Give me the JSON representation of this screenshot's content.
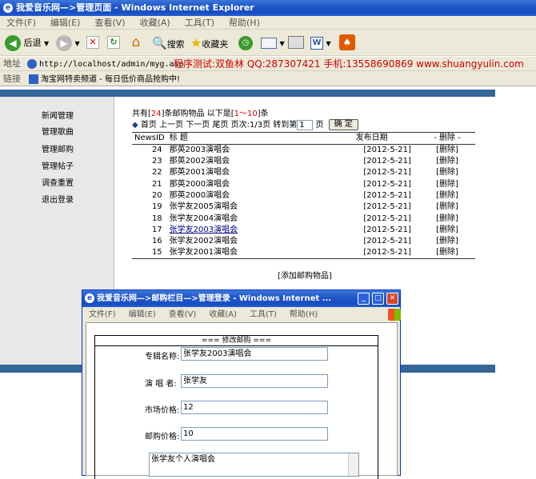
{
  "window": {
    "title": "我爱音乐网—>管理页面 - Windows Internet Explorer",
    "menu": [
      "文件(F)",
      "编辑(E)",
      "查看(V)",
      "收藏(A)",
      "工具(T)",
      "帮助(H)"
    ]
  },
  "toolbar": {
    "back_label": "后退",
    "search_label": "搜索",
    "favorites_label": "收藏夹"
  },
  "address": {
    "label": "地址",
    "url": "http://localhost/admin/myg.asp",
    "overlay_text": "程序测试:双鱼林 QQ:287307421 手机:13558690869 www.shuangyulin.com"
  },
  "links": {
    "label": "链接",
    "item": "淘宝网特卖频道 - 每日低价商品抢购中!"
  },
  "sidebar": {
    "items": [
      "新闻管理",
      "管理歌曲",
      "管理邮购",
      "管理帖子",
      "调查重置",
      "退出登录"
    ]
  },
  "summary": {
    "prefix": "共有[",
    "count": "24",
    "mid": "]条邮购物品 以下是[",
    "range": "1～10",
    "suffix": "]条"
  },
  "pager": {
    "diamond": "◆",
    "first": "首页",
    "prev": "上一页",
    "next": "下一页",
    "last": "尾页",
    "pageinfo": "页次:1/3页",
    "goto_prefix": "转到第",
    "page_value": "1",
    "goto_suffix": "页",
    "confirm": "确 定"
  },
  "table": {
    "headers": [
      "NewsID",
      "标 题",
      "发布日期",
      "- 删除 -"
    ],
    "rows": [
      {
        "id": "24",
        "title": "那英2003演唱会",
        "date": "[2012-5-21]",
        "del": "[删除]"
      },
      {
        "id": "23",
        "title": "那英2002演唱会",
        "date": "[2012-5-21]",
        "del": "[删除]"
      },
      {
        "id": "22",
        "title": "那英2001演唱会",
        "date": "[2012-5-21]",
        "del": "[删除]"
      },
      {
        "id": "21",
        "title": "那英2000演唱会",
        "date": "[2012-5-21]",
        "del": "[删除]"
      },
      {
        "id": "20",
        "title": "那英2000演唱会",
        "date": "[2012-5-21]",
        "del": "[删除]"
      },
      {
        "id": "19",
        "title": "张学友2005演唱会",
        "date": "[2012-5-21]",
        "del": "[删除]"
      },
      {
        "id": "18",
        "title": "张学友2004演唱会",
        "date": "[2012-5-21]",
        "del": "[删除]"
      },
      {
        "id": "17",
        "title": "张学友2003演唱会",
        "date": "[2012-5-21]",
        "del": "[删除]"
      },
      {
        "id": "16",
        "title": "张学友2002演唱会",
        "date": "[2012-5-21]",
        "del": "[删除]"
      },
      {
        "id": "15",
        "title": "张学友2001演唱会",
        "date": "[2012-5-21]",
        "del": "[删除]"
      }
    ]
  },
  "add_link": "[添加邮购物品]",
  "popup": {
    "title": "我爱音乐网—>邮购栏目—>管理登录 - Windows Internet ...",
    "menu": [
      "文件(F)",
      "编辑(E)",
      "查看(V)",
      "收藏(A)",
      "工具(T)",
      "帮助(H)"
    ],
    "heading": "=== 修改邮购 ===",
    "fields": {
      "album_label": "专辑名称:",
      "album_value": "张学友2003演唱会",
      "singer_label": "演 唱 者:",
      "singer_value": "张学友",
      "market_label": "市场价格:",
      "market_value": "12",
      "mail_label": "邮购价格:",
      "mail_value": "10",
      "desc_value": "张学友个人演唱会"
    }
  }
}
